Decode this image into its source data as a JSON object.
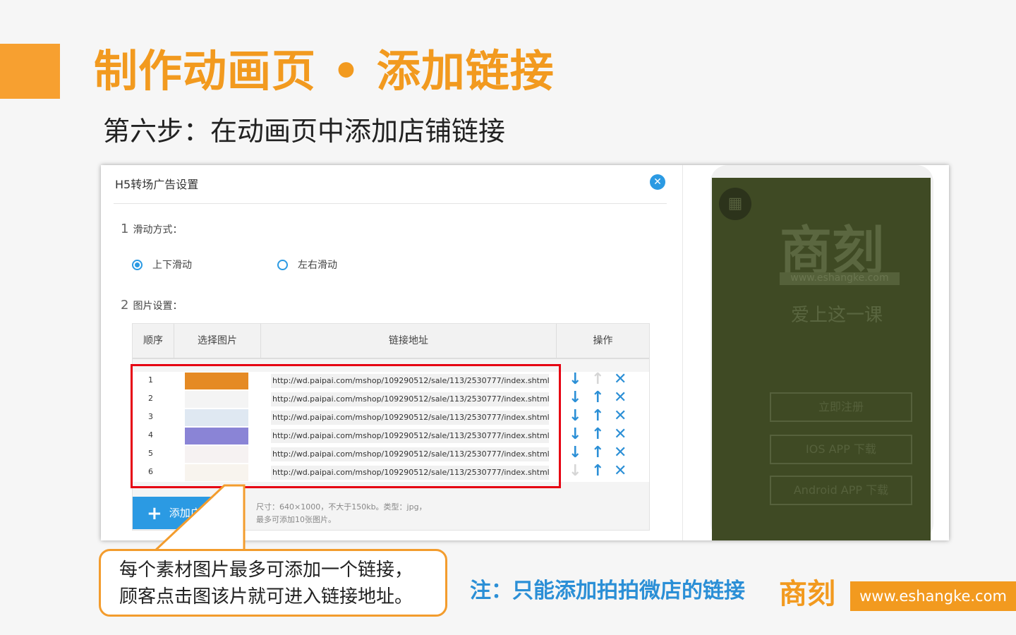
{
  "slide": {
    "title": "制作动画页 • 添加链接",
    "step": "第六步：在动画页中添加店铺链接"
  },
  "dialog": {
    "title": "H5转场广告设置",
    "close_icon": "close-icon",
    "section1": {
      "num": "1",
      "label": "滑动方式："
    },
    "radio_options": [
      {
        "label": "上下滑动",
        "selected": true
      },
      {
        "label": "左右滑动",
        "selected": false
      }
    ],
    "section2": {
      "num": "2",
      "label": "图片设置："
    },
    "table": {
      "headers": [
        "顺序",
        "选择图片",
        "链接地址",
        "操作"
      ],
      "rows": [
        {
          "order": "1",
          "url": "http://wd.paipai.com/mshop/109290512/sale/113/2530777/index.shtml?title=",
          "up_enabled": false,
          "down_enabled": true
        },
        {
          "order": "2",
          "url": "http://wd.paipai.com/mshop/109290512/sale/113/2530777/index.shtml?title=",
          "up_enabled": true,
          "down_enabled": true
        },
        {
          "order": "3",
          "url": "http://wd.paipai.com/mshop/109290512/sale/113/2530777/index.shtml?title=",
          "up_enabled": true,
          "down_enabled": true
        },
        {
          "order": "4",
          "url": "http://wd.paipai.com/mshop/109290512/sale/113/2530777/index.shtml?title=",
          "up_enabled": true,
          "down_enabled": true
        },
        {
          "order": "5",
          "url": "http://wd.paipai.com/mshop/109290512/sale/113/2530777/index.shtml?title=",
          "up_enabled": true,
          "down_enabled": true
        },
        {
          "order": "6",
          "url": "http://wd.paipai.com/mshop/109290512/sale/113/2530777/index.shtml?title=",
          "up_enabled": true,
          "down_enabled": false
        }
      ]
    },
    "add_button": "添加广告",
    "hint_line1": "尺寸：640×1000，不大于150kb。类型：jpg，",
    "hint_line2": "最多可添加10张图片。"
  },
  "phone": {
    "logo": "商刻",
    "url": "www.eshangke.com",
    "slogan": "爱上这一课",
    "buttons": [
      "立即注册",
      "IOS APP 下载",
      "Android APP 下载"
    ]
  },
  "callout": {
    "line1": "每个素材图片最多可添加一个链接，",
    "line2": "顾客点击图该片就可进入链接地址。"
  },
  "note": "注：只能添加拍拍微店的链接",
  "brand": {
    "logo": "商刻",
    "url": "www.eshangke.com"
  },
  "colors": {
    "accent": "#f29a1f",
    "blue": "#2b8fd6",
    "red_highlight": "#e60012"
  }
}
